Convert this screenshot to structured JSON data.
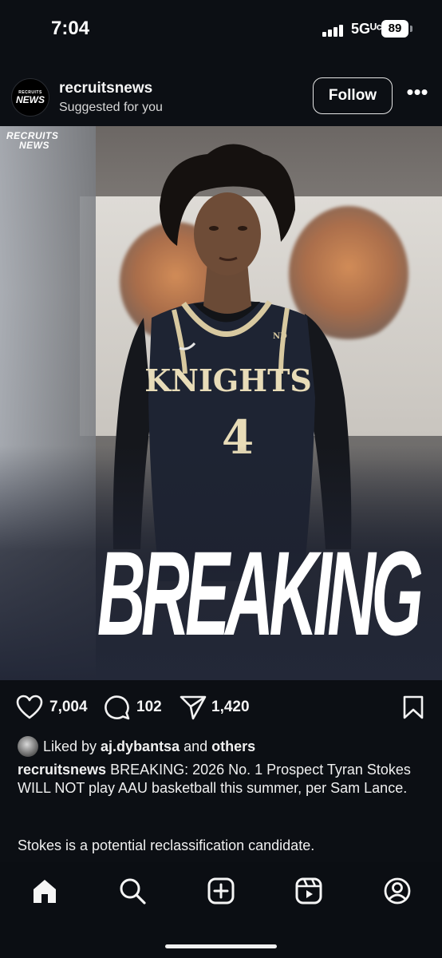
{
  "status_bar": {
    "time": "7:04",
    "network": "5Gᵁᶜ",
    "battery": "89"
  },
  "post": {
    "username": "recruitsnews",
    "subtitle": "Suggested for you",
    "avatar_line1": "RECRUITS",
    "avatar_line2": "NEWS",
    "follow_label": "Follow",
    "more_label": "•••"
  },
  "image": {
    "watermark_line1": "RECRUITS",
    "watermark_line2": "NEWS",
    "jersey_text": "KNIGHTS",
    "jersey_number": "4",
    "headline": "BREAKING"
  },
  "actions": {
    "likes": "7,004",
    "comments": "102",
    "shares": "1,420"
  },
  "caption": {
    "liked_prefix": "Liked by ",
    "liked_user": "aj.dybantsa",
    "liked_mid": " and ",
    "liked_suffix": "others",
    "author": "recruitsnews",
    "text": " BREAKING: 2026 No. 1 Prospect Tyran Stokes WILL NOT play AAU basketball this summer, per Sam Lance.",
    "text2": "Stokes is a potential reclassification candidate."
  },
  "colors": {
    "background": "#0c0f14",
    "text": "#f2f2f2",
    "jersey": "#1e2433",
    "jersey_trim": "#d8c9a0"
  },
  "icons": {
    "like": "heart-icon",
    "comment": "comment-icon",
    "share": "send-icon",
    "save": "bookmark-icon",
    "nav": [
      "home-icon",
      "search-icon",
      "create-icon",
      "reels-icon",
      "profile-icon"
    ]
  }
}
